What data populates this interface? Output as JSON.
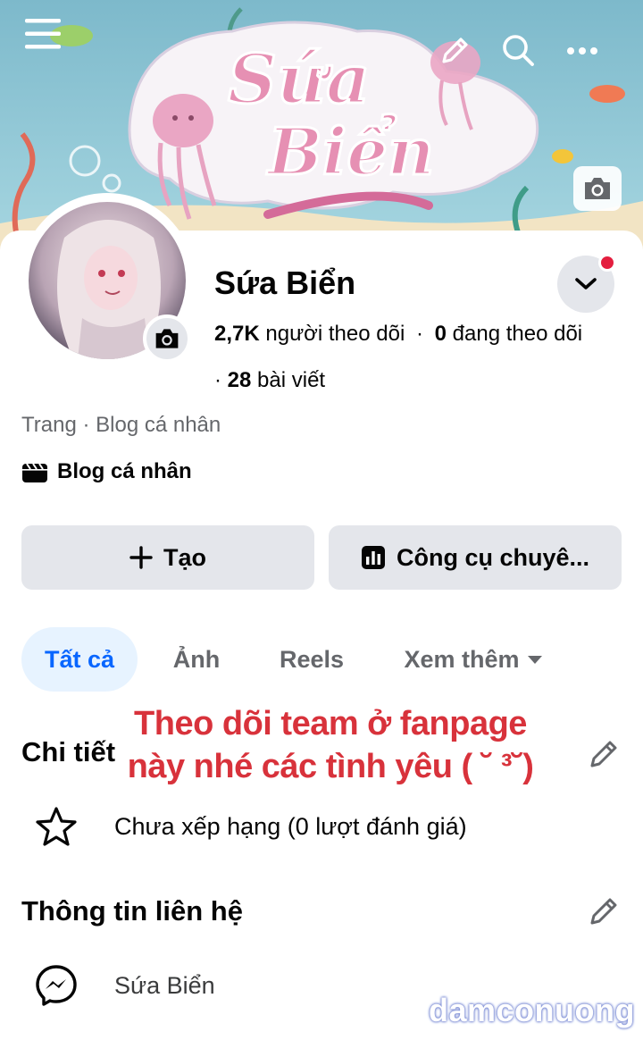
{
  "cover": {
    "title_line1": "Sứa",
    "title_line2": "Biển"
  },
  "topbar": {
    "menu_icon": "hamburger-icon",
    "edit_icon": "pencil-icon",
    "search_icon": "search-icon",
    "more_icon": "more-dots-icon",
    "cover_camera_icon": "camera-icon"
  },
  "profile": {
    "name": "Sứa Biển",
    "followers_count": "2,7K",
    "followers_label": "người theo dõi",
    "following_count": "0",
    "following_label": "đang theo dõi",
    "posts_prefix": "·",
    "posts_count": "28",
    "posts_label": "bài viết",
    "category_line": "Trang · Blog cá nhân",
    "blog_label": "Blog cá nhân",
    "has_notification": true
  },
  "actions": {
    "create_label": "Tạo",
    "tools_label": "Công cụ chuyê..."
  },
  "tabs": [
    {
      "label": "Tất cả",
      "active": true
    },
    {
      "label": "Ảnh",
      "active": false
    },
    {
      "label": "Reels",
      "active": false
    },
    {
      "label": "Xem thêm",
      "active": false
    }
  ],
  "overlay": {
    "line1": "Theo dõi team ở fanpage",
    "line2": "này nhé các tình yêu ( ˘ ³˘)"
  },
  "details": {
    "title": "Chi tiết",
    "rating_text": "Chưa xếp hạng (0 lượt đánh giá)"
  },
  "contact": {
    "title": "Thông tin liên hệ",
    "messenger_text": "Sứa Biển"
  },
  "watermark": "damconuong",
  "colors": {
    "accent": "#0866ff",
    "tab_active_bg": "#e7f3ff",
    "button_bg": "#e4e6eb",
    "overlay_text": "#d8323b",
    "notification": "#e41e3f",
    "cover_sky": "#8fc7d6",
    "cover_title": "#e690b3"
  }
}
